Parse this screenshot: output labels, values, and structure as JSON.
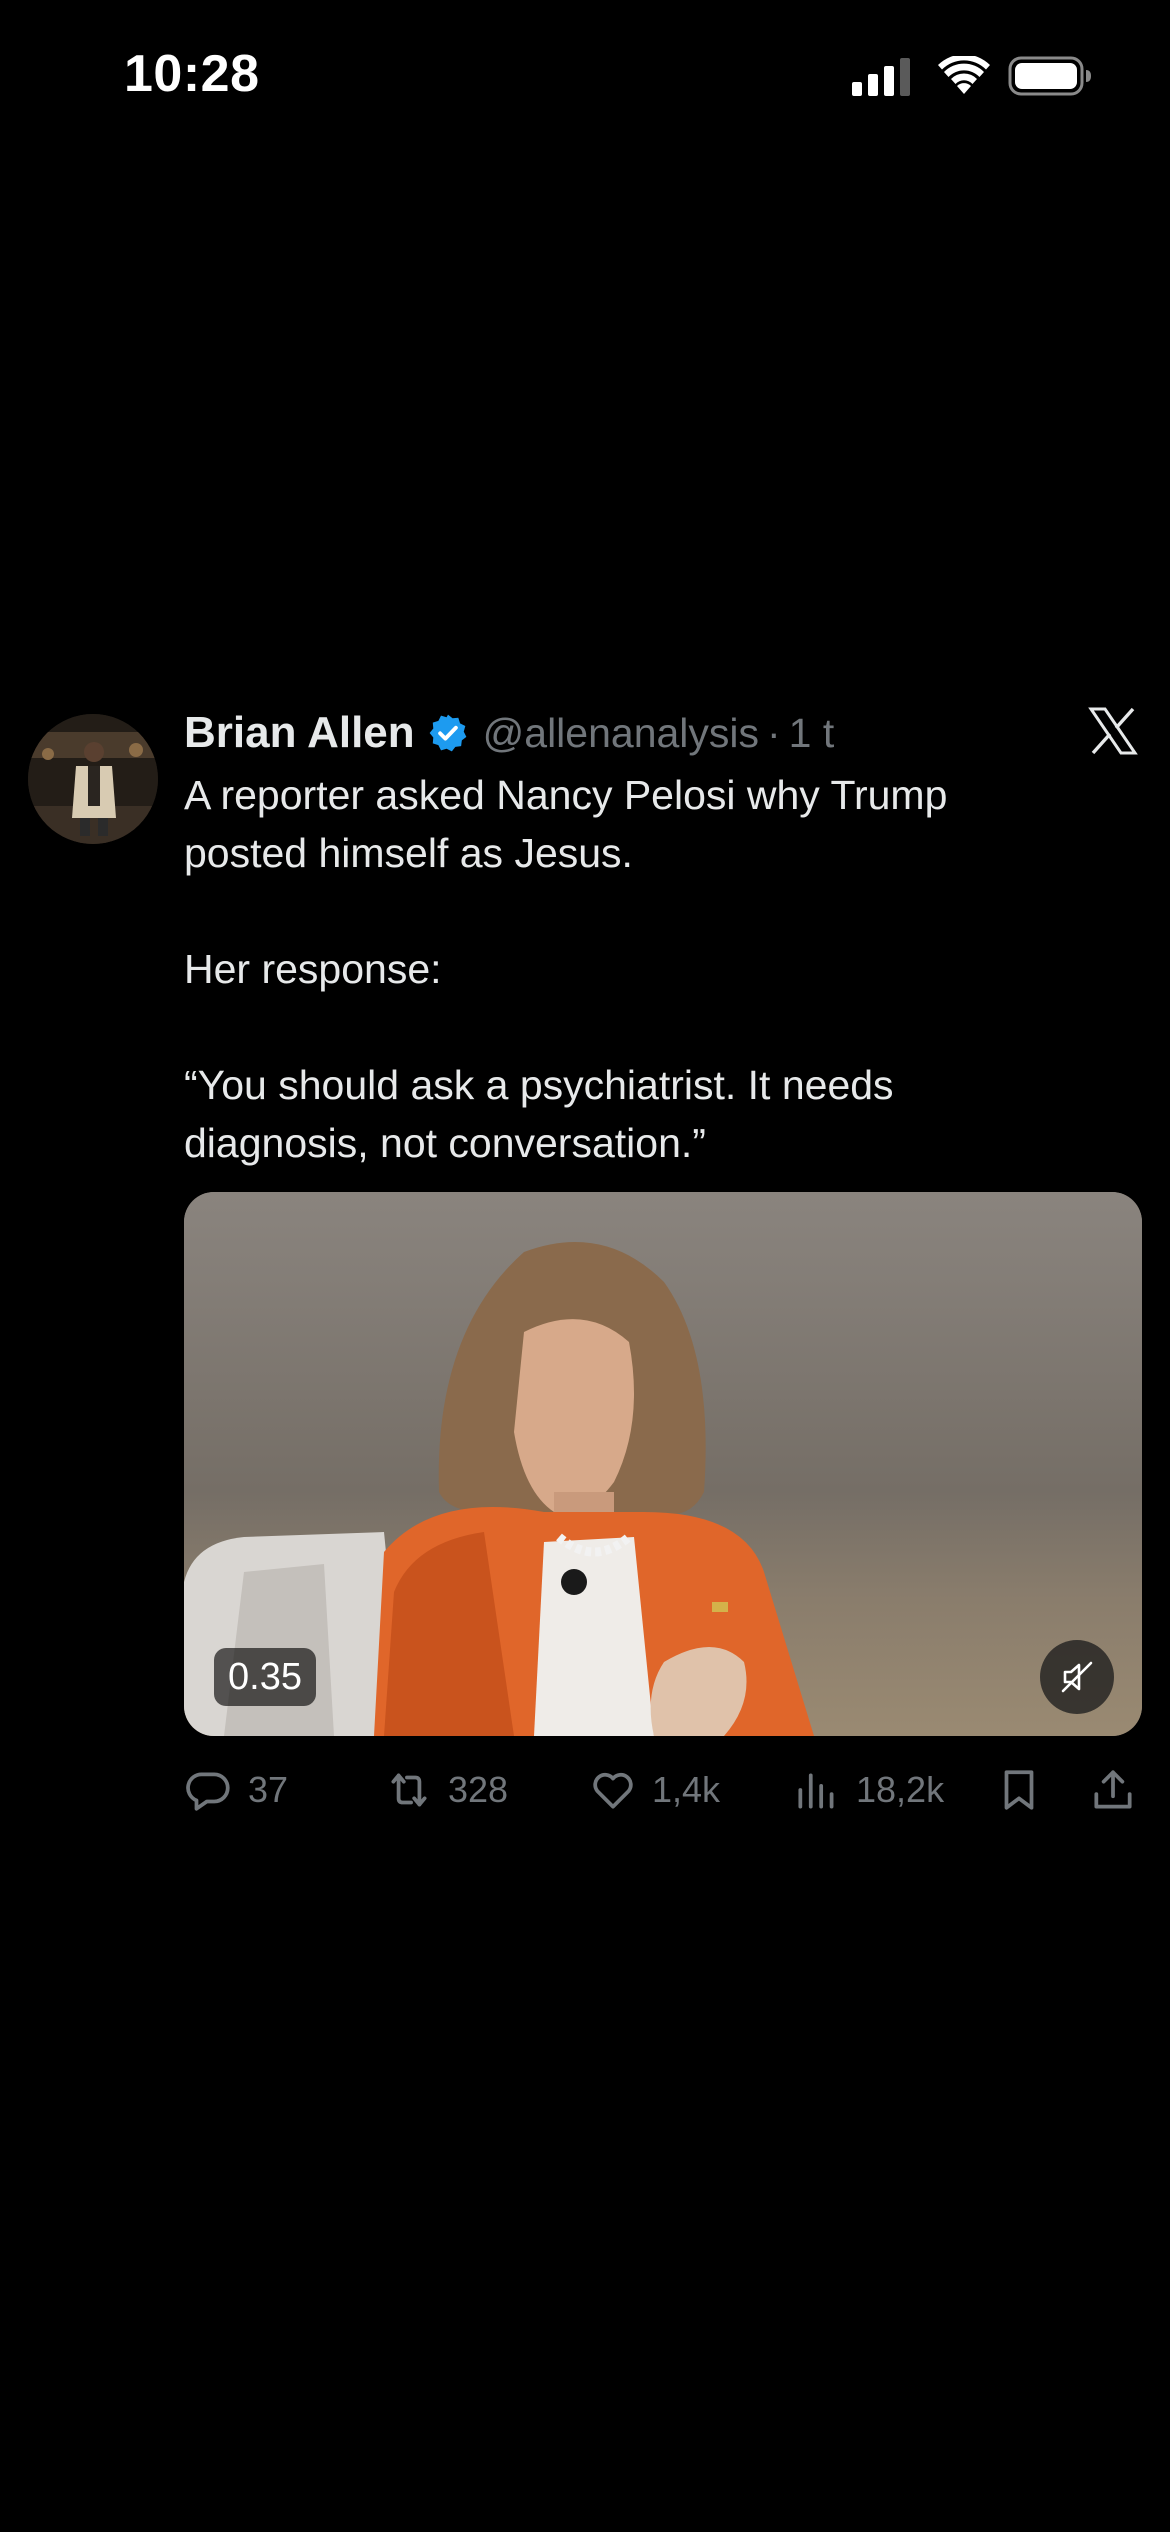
{
  "status_bar": {
    "time": "10:28",
    "icons": [
      "signal-icon",
      "wifi-icon",
      "battery-icon"
    ]
  },
  "tweet": {
    "author_name": "Brian Allen",
    "verified": true,
    "handle": "@allenanalysis",
    "separator": "·",
    "timestamp": "1 t",
    "text_lines": [
      "A reporter asked Nancy Pelosi why Trump",
      "posted himself as Jesus.",
      "",
      "Her response:",
      "",
      "“You should ask a psychiatrist. It needs",
      "diagnosis, not conversation.”"
    ],
    "media": {
      "type": "video",
      "duration": "0.35",
      "muted": true
    },
    "stats": {
      "replies": "37",
      "reposts": "328",
      "likes": "1,4k",
      "views": "18,2k"
    }
  },
  "colors": {
    "background": "#000000",
    "text_primary": "#e7e9ea",
    "text_secondary": "#71767b",
    "verified_blue": "#1d9bf0"
  }
}
